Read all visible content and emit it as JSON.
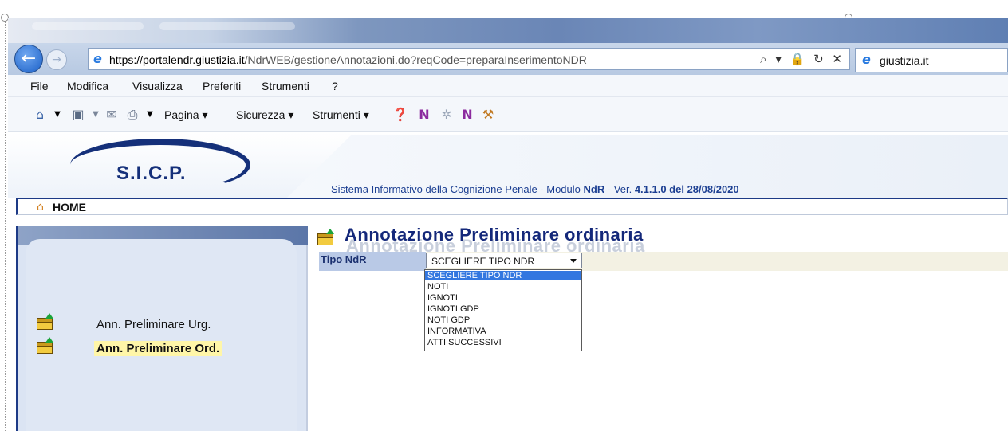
{
  "browser": {
    "url_domain": "https://portalendr.giustizia.it",
    "url_path": "/NdrWEB/gestioneAnnotazioni.do?reqCode=preparaInserimentoNDR",
    "tab_title": "giustizia.it",
    "url_controls": "⌕ ▾ 🔒 ↻ ✕"
  },
  "menu": {
    "items": [
      "File",
      "Modifica",
      "Visualizza",
      "Preferiti",
      "Strumenti",
      "?"
    ]
  },
  "commandbar": {
    "pagina": "Pagina ▾",
    "sicurezza": "Sicurezza ▾",
    "strumenti": "Strumenti ▾"
  },
  "header": {
    "logo": "S.I.C.P.",
    "system_title_pre": "Sistema Informativo della Cognizione Penale - Modulo ",
    "system_title_mod": "NdR",
    "system_title_mid": " - Ver. ",
    "system_title_ver": "4.1.1.0 del 28/08/2020"
  },
  "home": {
    "label": "HOME"
  },
  "sidebar": {
    "items": [
      {
        "label": "Ann. Preliminare Urg.",
        "active": false
      },
      {
        "label": "Ann. Preliminare Ord.",
        "active": true
      }
    ]
  },
  "main": {
    "title": "Annotazione Preliminare ordinaria",
    "field_label": "Tipo NdR",
    "select_value": "SCEGLIERE TIPO NDR",
    "options": [
      "SCEGLIERE TIPO NDR",
      "NOTI",
      "IGNOTI",
      "IGNOTI GDP",
      "NOTI GDP",
      "INFORMATIVA",
      "ATTI SUCCESSIVI"
    ],
    "selected_index": 0
  }
}
